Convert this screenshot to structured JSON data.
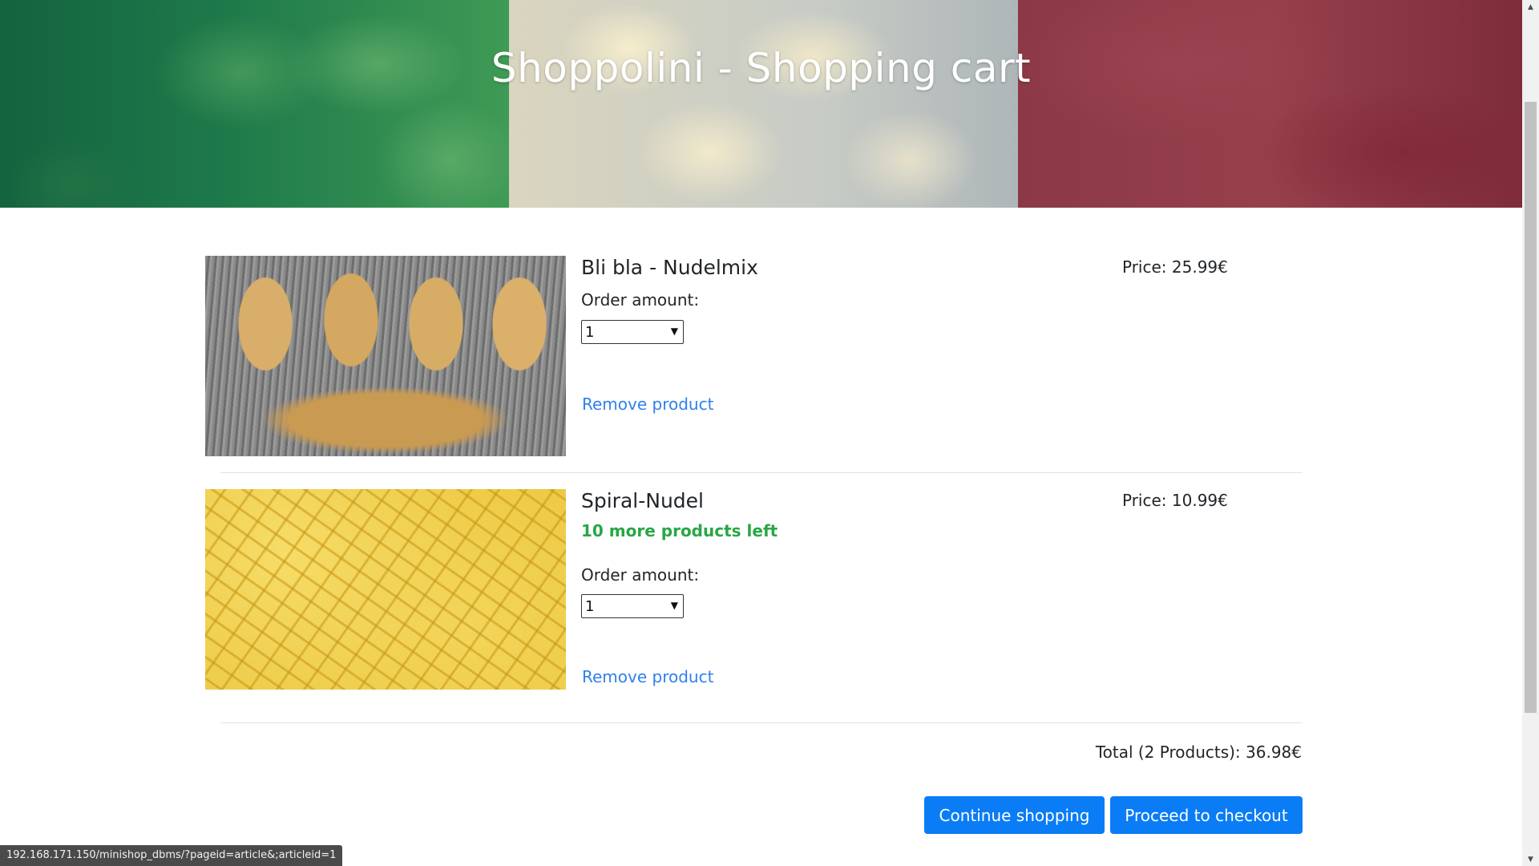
{
  "header": {
    "title": "Shoppolini - Shopping cart"
  },
  "cart": {
    "items": [
      {
        "name": "Bli bla - Nudelmix",
        "stock_note": "",
        "order_label": "Order amount:",
        "amount": "1",
        "remove_label": "Remove product",
        "price": "Price: 25.99€"
      },
      {
        "name": "Spiral-Nudel",
        "stock_note": "10 more products left",
        "order_label": "Order amount:",
        "amount": "1",
        "remove_label": "Remove product",
        "price": "Price: 10.99€"
      }
    ],
    "total": "Total (2 Products): 36.98€"
  },
  "actions": {
    "continue_label": "Continue shopping",
    "checkout_label": "Proceed to checkout"
  },
  "status_bar": {
    "url": "192.168.171.150/minishop_dbms/?pageid=article&;articleid=1"
  },
  "colors": {
    "accent": "#0a7cf6",
    "link": "#2f80ed",
    "stock": "#28a745"
  },
  "icons": {
    "select_arrow": "chevron-down-icon",
    "scroll_up": "arrow-up-icon",
    "scroll_down": "arrow-down-icon"
  }
}
